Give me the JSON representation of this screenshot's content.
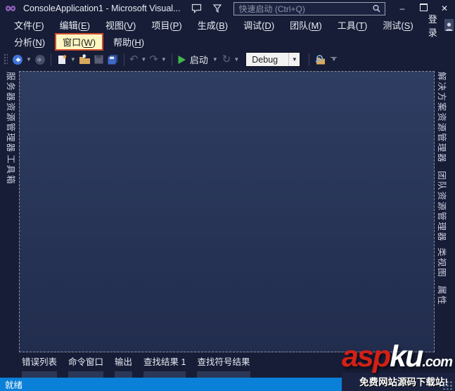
{
  "window": {
    "title": "ConsoleApplication1 - Microsoft Visual...",
    "search_placeholder": "快速启动 (Ctrl+Q)",
    "minimize": "–",
    "close": "✕"
  },
  "menu": {
    "row1": [
      {
        "id": "file",
        "pre": "文件(",
        "key": "F",
        "post": ")"
      },
      {
        "id": "edit",
        "pre": "编辑(",
        "key": "E",
        "post": ")"
      },
      {
        "id": "view",
        "pre": "视图(",
        "key": "V",
        "post": ")"
      },
      {
        "id": "project",
        "pre": "项目(",
        "key": "P",
        "post": ")"
      },
      {
        "id": "build",
        "pre": "生成(",
        "key": "B",
        "post": ")"
      },
      {
        "id": "debug",
        "pre": "调试(",
        "key": "D",
        "post": ")"
      },
      {
        "id": "team",
        "pre": "团队(",
        "key": "M",
        "post": ")"
      },
      {
        "id": "tools",
        "pre": "工具(",
        "key": "T",
        "post": ")"
      },
      {
        "id": "test",
        "pre": "测试(",
        "key": "S",
        "post": ")"
      }
    ],
    "row2": [
      {
        "id": "analyze",
        "pre": "分析(",
        "key": "N",
        "post": ")"
      },
      {
        "id": "window",
        "pre": "窗口(",
        "key": "W",
        "post": ")",
        "highlight": true
      },
      {
        "id": "help",
        "pre": "帮助(",
        "key": "H",
        "post": ")"
      }
    ],
    "sign_in": "登录"
  },
  "toolbar": {
    "start_label": "启动",
    "config_value": "Debug"
  },
  "left_tabs": [
    {
      "id": "server-explorer",
      "label": "服务器资源管理器"
    },
    {
      "id": "toolbox",
      "label": "工具箱"
    }
  ],
  "right_tabs": [
    {
      "id": "solution-explorer",
      "label": "解决方案资源管理器"
    },
    {
      "id": "team-explorer",
      "label": "团队资源管理器"
    },
    {
      "id": "class-view",
      "label": "类视图"
    },
    {
      "id": "properties",
      "label": "属性"
    }
  ],
  "bottom_tabs": [
    {
      "id": "error-list",
      "label": "错误列表"
    },
    {
      "id": "command-window",
      "label": "命令窗口"
    },
    {
      "id": "output",
      "label": "输出"
    },
    {
      "id": "find-results-1",
      "label": "查找结果 1"
    },
    {
      "id": "find-symbol-results",
      "label": "查找符号结果"
    }
  ],
  "status_bar": {
    "text": "就绪"
  },
  "watermark": {
    "logo_asp": "asp",
    "logo_ku": "ku",
    "logo_tld": ".com",
    "slogan": "免费网站源码下载站!"
  },
  "colors": {
    "status_blue": "#0a80d8",
    "highlight_bg": "#fdf5c2",
    "highlight_border": "#d14a2e",
    "vs_purple": "#8a5fb4",
    "start_green": "#43b64d",
    "logo_red": "#d32016",
    "chrome_navy": "#171d36",
    "well_navy": "#273456"
  }
}
